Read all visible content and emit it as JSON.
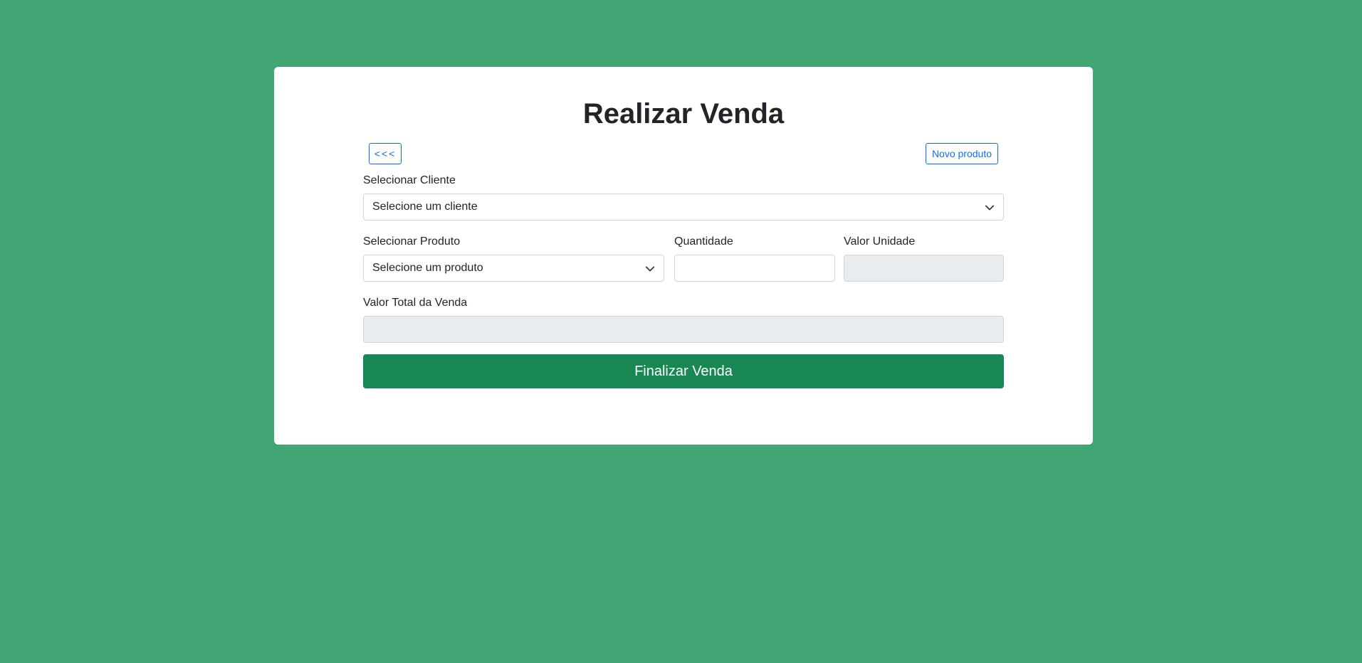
{
  "page": {
    "title": "Realizar Venda"
  },
  "toolbar": {
    "back_label": "<<<",
    "new_product_label": "Novo produto"
  },
  "form": {
    "client_label": "Selecionar Cliente",
    "client_selected": "Selecione um cliente",
    "product_label": "Selecionar Produto",
    "product_selected": "Selecione um produto",
    "quantity_label": "Quantidade",
    "quantity_value": "",
    "unit_value_label": "Valor Unidade",
    "unit_value": "",
    "total_label": "Valor Total da Venda",
    "total_value": "",
    "submit_label": "Finalizar Venda"
  },
  "colors": {
    "background": "#42a574",
    "primary_outline": "#0d6efd",
    "success": "#198754",
    "disabled_field": "#e9ecef"
  },
  "icons": {
    "select_chevron": "chevron-down-icon"
  }
}
